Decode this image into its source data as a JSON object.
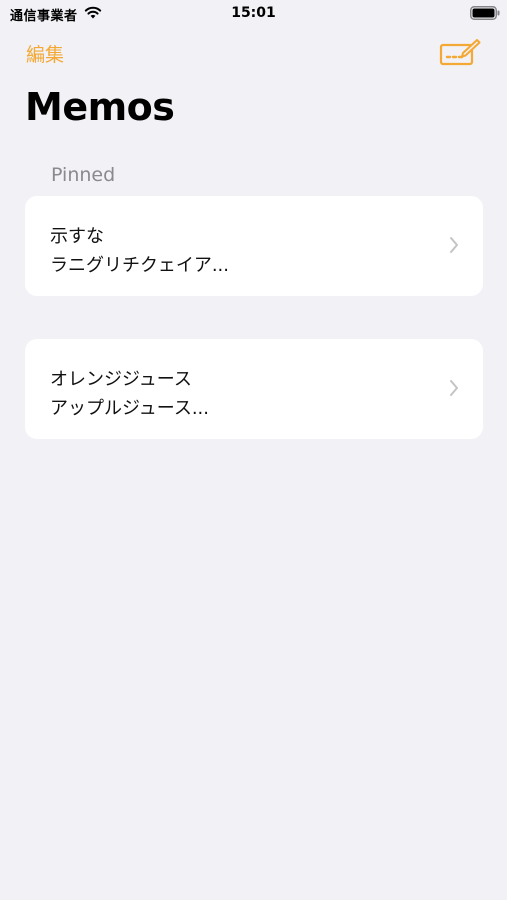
{
  "status_bar": {
    "carrier": "通信事業者",
    "time": "15:01",
    "wifi_icon": "wifi-icon",
    "battery_icon": "battery-icon"
  },
  "nav": {
    "edit_label": "編集",
    "compose_icon": "compose-icon"
  },
  "page": {
    "title": "Memos"
  },
  "sections": {
    "pinned_header": "Pinned"
  },
  "memos": [
    {
      "line1": "示すな",
      "line2": "ラニグリチクェイア..."
    },
    {
      "line1": "オレンジジュース",
      "line2": "アップルジュース..."
    }
  ],
  "colors": {
    "accent": "#f3a934",
    "background": "#f2f1f6",
    "card": "#ffffff",
    "secondary_text": "#8a8a8e",
    "chevron": "#c4c4c7"
  }
}
